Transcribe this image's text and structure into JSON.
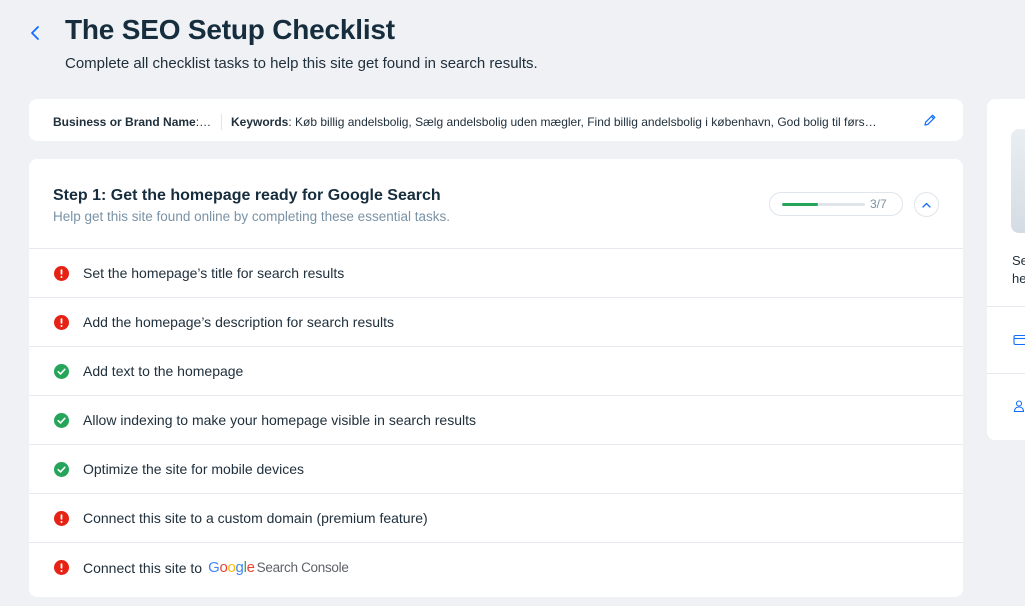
{
  "header": {
    "title": "The SEO Setup Checklist",
    "subtitle": "Complete all checklist tasks to help this site get found in search results."
  },
  "info_bar": {
    "business_label": "Business or Brand Name",
    "business_value": ": A…",
    "keywords_label": "Keywords",
    "keywords_value": ": Køb billig andelsbolig, Sælg andelsbolig uden mægler, Find billig andelsbolig i københavn, God bolig til førs…"
  },
  "step": {
    "title": "Step 1: Get the homepage ready for Google Search",
    "subtitle": "Help get this site found online by completing these essential tasks.",
    "progress_text": "3/7",
    "progress_fraction": 0.43,
    "tasks": [
      {
        "label": "Set the homepage’s title for search results",
        "status": "incomplete"
      },
      {
        "label": "Add the homepage’s description for search results",
        "status": "incomplete"
      },
      {
        "label": "Add text to the homepage",
        "status": "complete"
      },
      {
        "label": "Allow indexing to make your homepage visible in search results",
        "status": "complete"
      },
      {
        "label": "Optimize the site for mobile devices",
        "status": "complete"
      },
      {
        "label": "Connect this site to a custom domain (premium feature)",
        "status": "incomplete"
      },
      {
        "label": "Connect this site to",
        "status": "incomplete",
        "brand_google": "Google",
        "brand_suffix": "Search Console"
      }
    ]
  },
  "side_panel": {
    "text_line1": "Se",
    "text_line2": "he"
  },
  "colors": {
    "accent": "#116dff",
    "success": "#25a55a",
    "error": "#e62214",
    "background": "#eff1f4"
  }
}
